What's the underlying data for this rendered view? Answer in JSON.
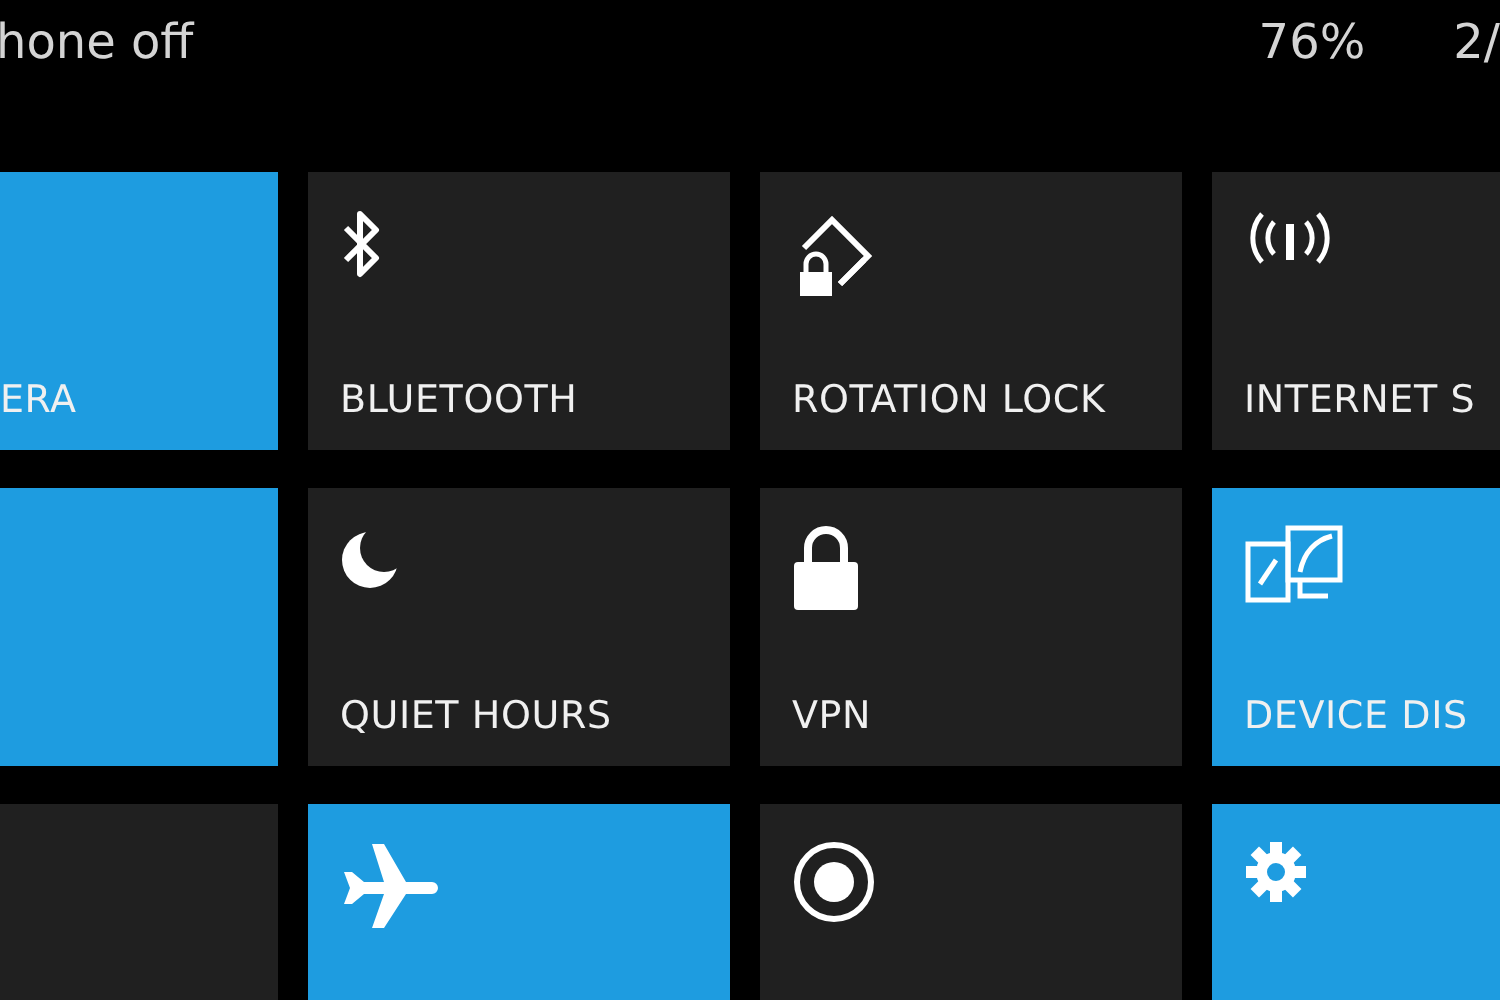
{
  "status_bar": {
    "text": "hone off",
    "battery": "76%",
    "time": "2/"
  },
  "tiles": [
    {
      "label": "ERA",
      "on": true
    },
    {
      "label": "BLUETOOTH",
      "on": false,
      "kind": "bluetooth"
    },
    {
      "label": "ROTATION LOCK",
      "on": false,
      "kind": "rotation-lock"
    },
    {
      "label": "INTERNET S",
      "on": false,
      "kind": "antenna"
    },
    {
      "on": true
    },
    {
      "label": "QUIET HOURS",
      "on": false,
      "kind": "moon"
    },
    {
      "label": "VPN",
      "on": false,
      "kind": "lock"
    },
    {
      "label": "DEVICE DIS",
      "on": true,
      "kind": "screens"
    },
    {
      "on": false
    },
    {
      "on": true,
      "kind": "airplane"
    },
    {
      "on": false,
      "kind": "record"
    },
    {
      "on": true,
      "kind": "gear"
    }
  ]
}
